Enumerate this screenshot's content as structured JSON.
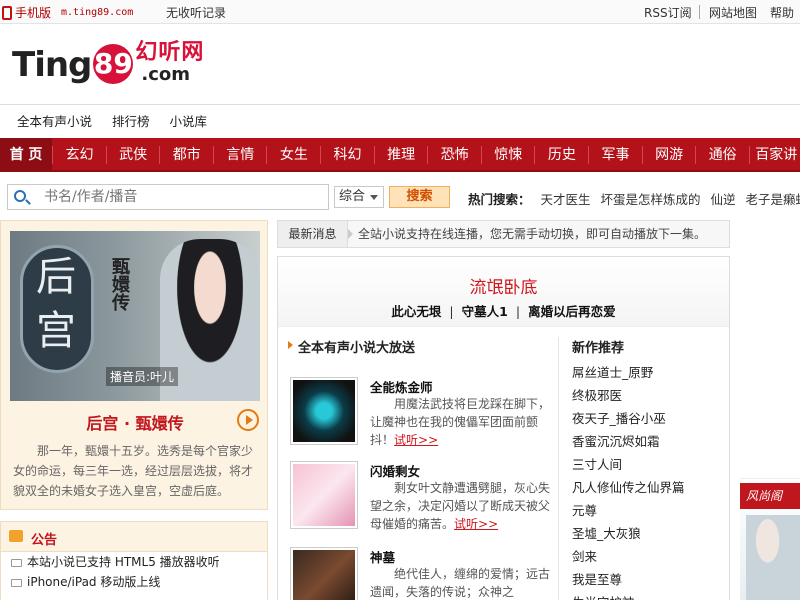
{
  "topbar": {
    "mobile_label": "手机版",
    "mobile_url": "m.ting89.com",
    "history": "无收听记录",
    "rss": "RSS订阅",
    "sitemap": "网站地图",
    "help": "帮助"
  },
  "logo": {
    "ting": "Ting",
    "num": "89",
    "cn": "幻听网",
    "com": ".com"
  },
  "subnav": [
    "全本有声小说",
    "排行榜",
    "小说库"
  ],
  "mainnav": {
    "home": "首 页",
    "items": [
      "玄幻",
      "武侠",
      "都市",
      "言情",
      "女生",
      "科幻",
      "推理",
      "恐怖",
      "惊悚",
      "历史",
      "军事",
      "网游",
      "通俗",
      "百家讲"
    ]
  },
  "search": {
    "placeholder": "书名/作者/播音",
    "select_value": "综合",
    "button": "搜索",
    "hot_label": "热门搜索：",
    "hot_words": [
      "天才医生",
      "坏蛋是怎样炼成的",
      "仙逆",
      "老子是癞蛤蟆"
    ]
  },
  "feature": {
    "cover_t1": "后",
    "cover_t2": "宫",
    "cover_t3": "甄嬛传",
    "cover_cast": "播音员:叶儿",
    "title": "后宫 · 甄嬛传",
    "desc": "那一年，甄嬛十五岁。选秀是每个官家少女的命运，每三年一选，经过层层选拔，将才貌双全的未婚女子选入皇宫，空虚后庭。"
  },
  "notice": {
    "title": "公告",
    "items": [
      "本站小说已支持 HTML5 播放器收听",
      "iPhone/iPad 移动版上线"
    ]
  },
  "news": {
    "label": "最新消息",
    "message": "全站小说支持在线连播，您无需手动切换，即可自动播放下一集。"
  },
  "center": {
    "banner_title": "流氓卧底",
    "banner_links": [
      "此心无垠",
      "守墓人1",
      "离婚以后再恋爱"
    ],
    "section_title": "全本有声小说大放送",
    "books": [
      {
        "name": "全能炼金师",
        "desc": "用魔法武技将巨龙踩在脚下，让魔神也在我的傀儡军团面前颤抖！",
        "link": "试听>>"
      },
      {
        "name": "闪婚剩女",
        "desc": "剩女叶文静遭遇劈腿，灰心失望之余，决定闪婚以了断成天被父母催婚的痛苦。",
        "link": "试听>>"
      },
      {
        "name": "神墓",
        "desc": "绝代佳人，缠绵的爱情；远古遗闻，失落的传说；众神之",
        "link": "试听>>"
      }
    ],
    "new_title": "新作推荐",
    "new_items": [
      "屌丝道士_原野",
      "终极邪医",
      "夜天子_播谷小巫",
      "香蜜沉沉烬如霜",
      "三寸人间",
      "凡人修仙传之仙界篇",
      "元尊",
      "圣墟_大灰狼",
      "剑来",
      "我是至尊",
      "生肖守护神"
    ]
  },
  "ad": {
    "tag": "风尚阁"
  },
  "colors": {
    "nav_red": "#b4121a",
    "accent_red": "#d0161e",
    "orange": "#e57a12"
  }
}
